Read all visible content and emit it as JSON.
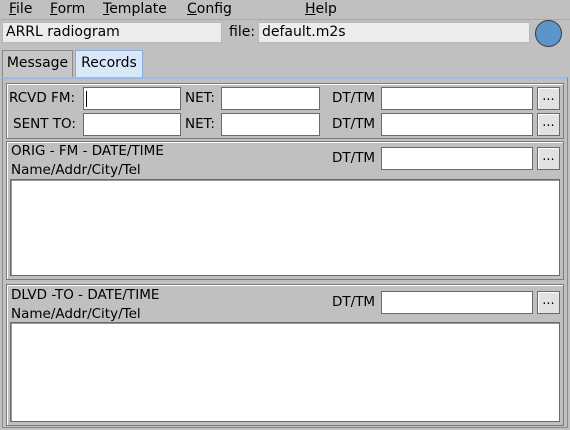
{
  "menu": {
    "items": [
      "File",
      "Form",
      "Template",
      "Config",
      "Help"
    ],
    "shortcut_letters": [
      "F",
      "F",
      "T",
      "C",
      "H"
    ],
    "rest": [
      "ile",
      "orm",
      "emplate",
      "onfig",
      "elp"
    ]
  },
  "header": {
    "form_title": "ARRL radiogram",
    "file_label": "file:",
    "file_name": "default.m2s",
    "status_color": "#5b95c9"
  },
  "tabs": [
    {
      "label": "Message",
      "active": false
    },
    {
      "label": "Records",
      "active": true
    }
  ],
  "records": {
    "rcvd_label": "RCVD FM:",
    "sent_label": "SENT TO:",
    "net_label": "NET:",
    "dttm_label": "DT/TM",
    "button_label": "...",
    "orig_title": "ORIG - FM - DATE/TIME",
    "orig_sub": "Name/Addr/City/Tel",
    "dlvd_title": "DLVD -TO - DATE/TIME",
    "dlvd_sub": "Name/Addr/City/Tel"
  },
  "colors": {
    "background": "#c0c0c0",
    "active_tab": "#d8e8f8",
    "field": "#ffffff"
  }
}
